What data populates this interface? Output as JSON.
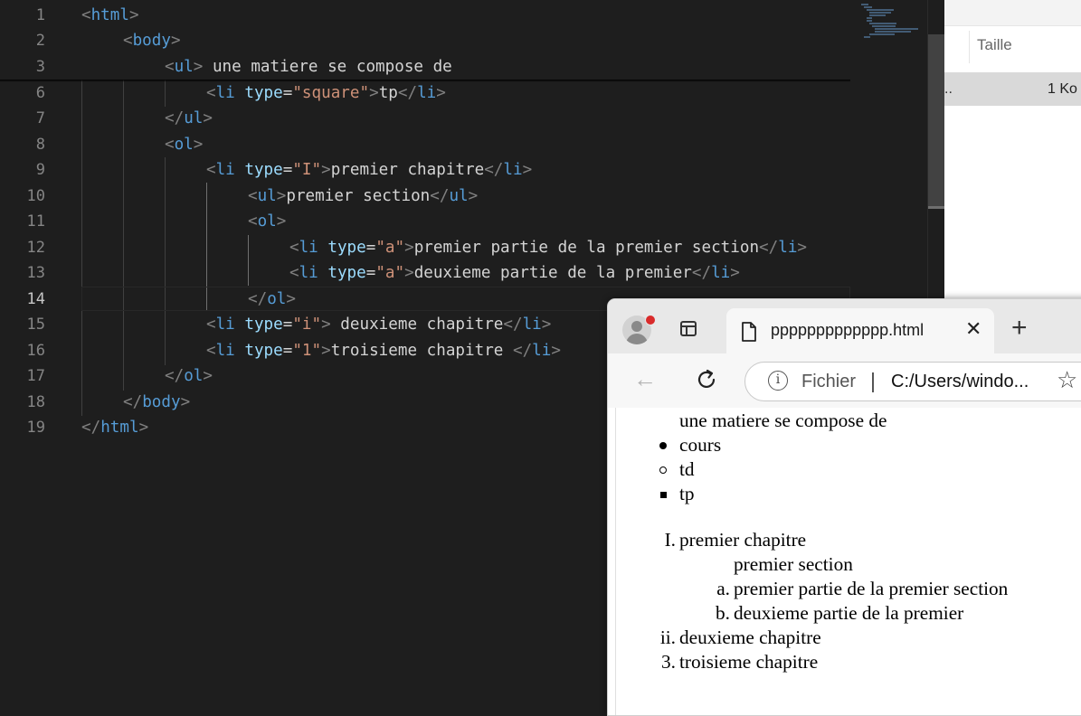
{
  "editor": {
    "lines": [
      {
        "num": "1"
      },
      {
        "num": "2"
      },
      {
        "num": "3"
      },
      {
        "num": "6"
      },
      {
        "num": "7"
      },
      {
        "num": "8"
      },
      {
        "num": "9"
      },
      {
        "num": "10"
      },
      {
        "num": "11"
      },
      {
        "num": "12"
      },
      {
        "num": "13"
      },
      {
        "num": "14"
      },
      {
        "num": "15"
      },
      {
        "num": "16"
      },
      {
        "num": "17"
      },
      {
        "num": "18"
      },
      {
        "num": "19"
      }
    ],
    "active_line": "14",
    "code": {
      "l1_tag": "html",
      "l2_tag": "body",
      "l3_tag": "ul",
      "l3_text": " une matiere se compose de",
      "l6_tag": "li",
      "l6_attr": "type",
      "l6_value": "\"square\"",
      "l6_text": "tp",
      "l6_close": "li",
      "l7_close": "ul",
      "l8_tag": "ol",
      "l9_tag": "li",
      "l9_attr": "type",
      "l9_value": "\"I\"",
      "l9_text": "premier chapitre",
      "l9_close": "li",
      "l10_tag": "ul",
      "l10_text": "premier section",
      "l10_close": "ul",
      "l11_tag": "ol",
      "l12_tag": "li",
      "l12_attr": "type",
      "l12_value": "\"a\"",
      "l12_text": "premier partie de la premier section",
      "l12_close": "li",
      "l13_tag": "li",
      "l13_attr": "type",
      "l13_value": "\"a\"",
      "l13_text": "deuxieme partie de la premier",
      "l13_close": "li",
      "l14_close": "ol",
      "l15_tag": "li",
      "l15_attr": "type",
      "l15_value": "\"i\"",
      "l15_text": " deuxieme chapitre",
      "l15_close": "li",
      "l16_tag": "li",
      "l16_attr": "type",
      "l16_value": "\"1\"",
      "l16_text": "troisieme chapitre ",
      "l16_close": "li",
      "l17_close": "ol",
      "l18_close": "body",
      "l19_close": "html"
    }
  },
  "explorer": {
    "column_header": "Taille",
    "row_name": "..",
    "row_size": "1 Ko"
  },
  "browser": {
    "tab_title": "ppppppppppppp.html",
    "address_scheme_label": "Fichier",
    "address_url": "C:/Users/windo...",
    "icons": {
      "profile": "avatar-icon",
      "tabs": "tab-actions-icon",
      "page": "document-icon",
      "close": "close-icon",
      "new_tab": "plus-icon",
      "back": "back-arrow-icon",
      "reload": "reload-icon",
      "info": "info-icon",
      "favorite": "star-icon"
    },
    "page": {
      "intro": "une matiere se compose de",
      "ul_items": [
        "cours",
        "td",
        "tp"
      ],
      "ch1_marker": "I.",
      "ch1": "premier chapitre",
      "section": "premier section",
      "part_a_marker": "a.",
      "part_a": "premier partie de la premier section",
      "part_b_marker": "b.",
      "part_b": "deuxieme partie de la premier",
      "ch2_marker": "ii.",
      "ch2": "deuxieme chapitre",
      "ch3_marker": "3.",
      "ch3": "troisieme chapitre"
    }
  },
  "colors": {
    "editor_bg": "#1e1e1e",
    "tag": "#569cd6",
    "attribute": "#9cdcfe",
    "string": "#ce9178",
    "profile_badge": "#d92b2b"
  }
}
